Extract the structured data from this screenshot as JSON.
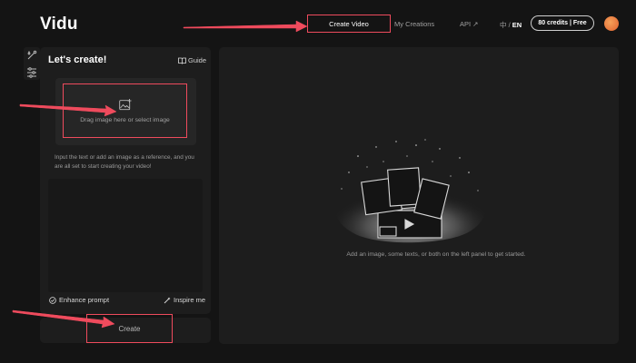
{
  "header": {
    "logo": "Vidu",
    "nav": [
      {
        "label": "Create Video",
        "active": true
      },
      {
        "label": "My Creations"
      },
      {
        "label": "API ↗"
      }
    ],
    "lang_zh": "中",
    "lang_sep": " / ",
    "lang_en": "EN",
    "credits": "80 credits | Free"
  },
  "sidebar": {
    "icons": [
      "magic-wand-icon",
      "sliders-icon"
    ]
  },
  "panel": {
    "title": "Let's create!",
    "guide": "Guide",
    "upload_text": "Drag image here or select image",
    "hint": "Input the text or add an image as a reference, and you are all set to start creating your video!",
    "enhance": "Enhance prompt",
    "inspire": "Inspire me",
    "create": "Create"
  },
  "preview": {
    "message": "Add an image, some texts, or both on the left panel to get started."
  },
  "colors": {
    "background": "#141414",
    "panel": "#1d1d1d",
    "annotation": "#ef4b5d"
  }
}
